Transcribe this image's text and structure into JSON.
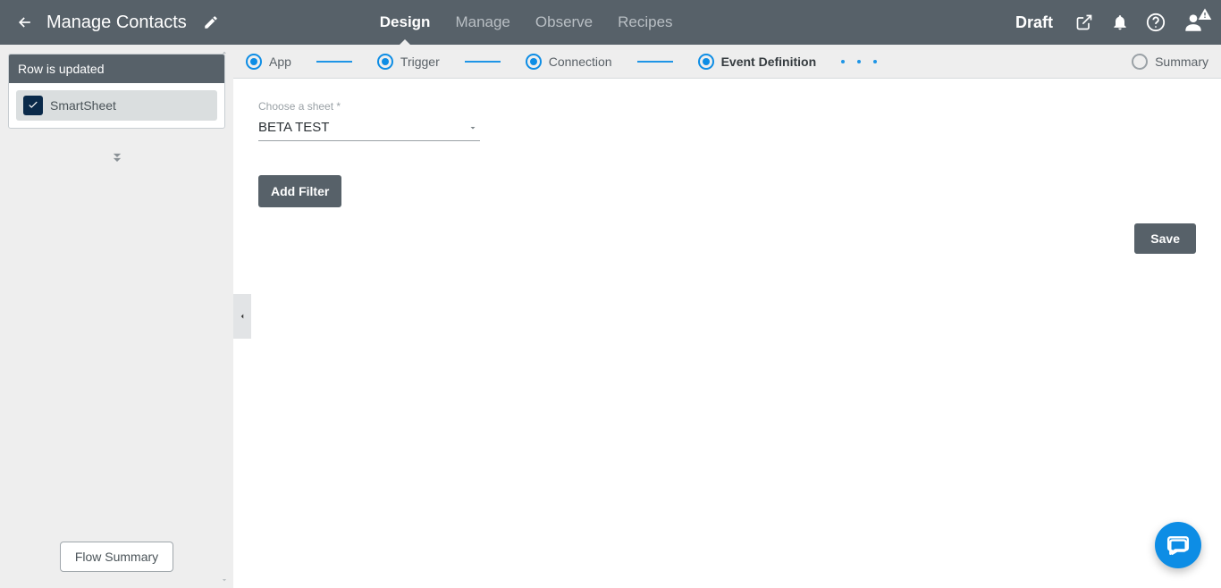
{
  "header": {
    "title": "Manage Contacts",
    "tabs": [
      "Design",
      "Manage",
      "Observe",
      "Recipes"
    ],
    "active_tab": 0,
    "status": "Draft"
  },
  "sidebar": {
    "card_title": "Row is updated",
    "app_name": "SmartSheet",
    "flow_summary_label": "Flow Summary"
  },
  "stepper": {
    "steps": [
      "App",
      "Trigger",
      "Connection",
      "Event Definition",
      "Summary"
    ],
    "current": 3
  },
  "form": {
    "sheet_label": "Choose a sheet *",
    "sheet_value": "BETA TEST",
    "add_filter_label": "Add Filter",
    "save_label": "Save"
  }
}
